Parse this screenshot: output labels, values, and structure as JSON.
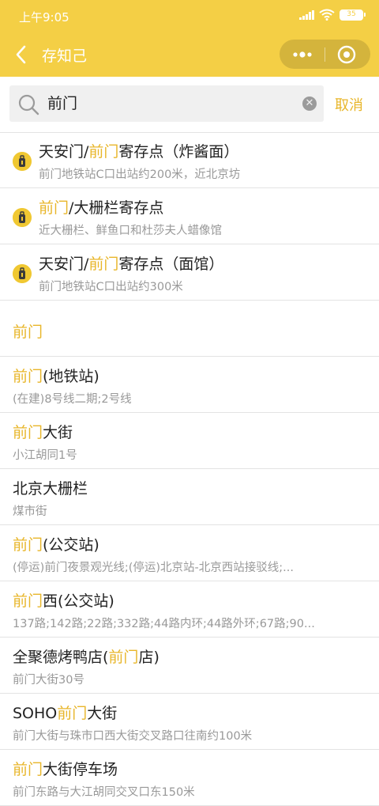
{
  "status_bar": {
    "time": "上午9:05",
    "battery": "35"
  },
  "header": {
    "title": "存知己"
  },
  "search": {
    "value": "前门",
    "cancel_label": "取消"
  },
  "storage_points": [
    {
      "parts": [
        {
          "text": "天安门/"
        },
        {
          "text": "前门",
          "hl": true
        },
        {
          "text": "寄存点（炸酱面）"
        }
      ],
      "address": "前门地铁站C口出站约200米，近北京坊"
    },
    {
      "parts": [
        {
          "text": "前门",
          "hl": true
        },
        {
          "text": "/大栅栏寄存点"
        }
      ],
      "address": "近大栅栏、鲜鱼口和杜莎夫人蜡像馆"
    },
    {
      "parts": [
        {
          "text": "天安门/"
        },
        {
          "text": "前门",
          "hl": true
        },
        {
          "text": "寄存点（面馆）"
        }
      ],
      "address": "前门地铁站C口出站约300米"
    }
  ],
  "group_heading": "前门",
  "places": [
    {
      "parts": [
        {
          "text": "前门",
          "hl": true
        },
        {
          "text": "(地铁站)"
        }
      ],
      "detail": "(在建)8号线二期;2号线"
    },
    {
      "parts": [
        {
          "text": "前门",
          "hl": true
        },
        {
          "text": "大街"
        }
      ],
      "detail": "小江胡同1号"
    },
    {
      "parts": [
        {
          "text": "北京大栅栏"
        }
      ],
      "detail": "煤市街"
    },
    {
      "parts": [
        {
          "text": "前门",
          "hl": true
        },
        {
          "text": "(公交站)"
        }
      ],
      "detail": "(停运)前门夜景观光线;(停运)北京站-北京西站接驳线;..."
    },
    {
      "parts": [
        {
          "text": "前门",
          "hl": true
        },
        {
          "text": "西(公交站)"
        }
      ],
      "detail": "137路;142路;22路;332路;44路内环;44路外环;67路;90..."
    },
    {
      "parts": [
        {
          "text": "全聚德烤鸭店("
        },
        {
          "text": "前门",
          "hl": true
        },
        {
          "text": "店)"
        }
      ],
      "detail": "前门大街30号"
    },
    {
      "parts": [
        {
          "text": "SOHO"
        },
        {
          "text": "前门",
          "hl": true
        },
        {
          "text": "大街"
        }
      ],
      "detail": "前门大街与珠市口西大街交叉路口往南约100米"
    },
    {
      "parts": [
        {
          "text": "前门",
          "hl": true
        },
        {
          "text": "大街停车场"
        }
      ],
      "detail": "前门东路与大江胡同交叉口东150米"
    }
  ],
  "colors": {
    "accent": "#f4cf45",
    "highlight": "#e8b62a"
  },
  "icons": {
    "back": "chevron-left-icon",
    "more": "more-dots-icon",
    "close": "capsule-close-icon",
    "search": "search-icon",
    "clear": "clear-icon",
    "pin": "luggage-pin-icon"
  }
}
